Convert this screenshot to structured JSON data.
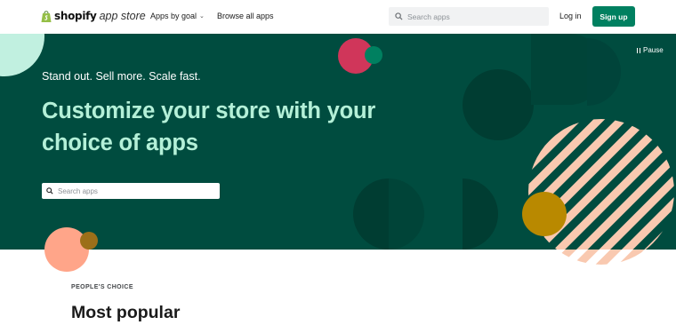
{
  "nav": {
    "logo_word": "shopify",
    "logo_sub": "app store",
    "apps_by_goal": "Apps by goal",
    "browse_all": "Browse all apps",
    "search_placeholder": "Search apps",
    "login": "Log in",
    "signup": "Sign up"
  },
  "hero": {
    "pause_label": "Pause",
    "kicker": "Stand out. Sell more. Scale fast.",
    "headline": "Customize your store with your choice of apps",
    "search_placeholder": "Search apps"
  },
  "section": {
    "eyebrow": "PEOPLE'S CHOICE",
    "title": "Most popular"
  },
  "colors": {
    "hero_bg": "#004c3f",
    "brand_green": "#008060",
    "headline_mint": "#b4f0d8",
    "accent_pink": "#d0365a",
    "accent_peach": "#ffa589",
    "accent_gold": "#b98900",
    "stripe_peach": "#f9c9b0"
  },
  "icons": [
    "shopify-bag-icon",
    "chevron-down-icon",
    "search-icon",
    "pause-icon"
  ]
}
